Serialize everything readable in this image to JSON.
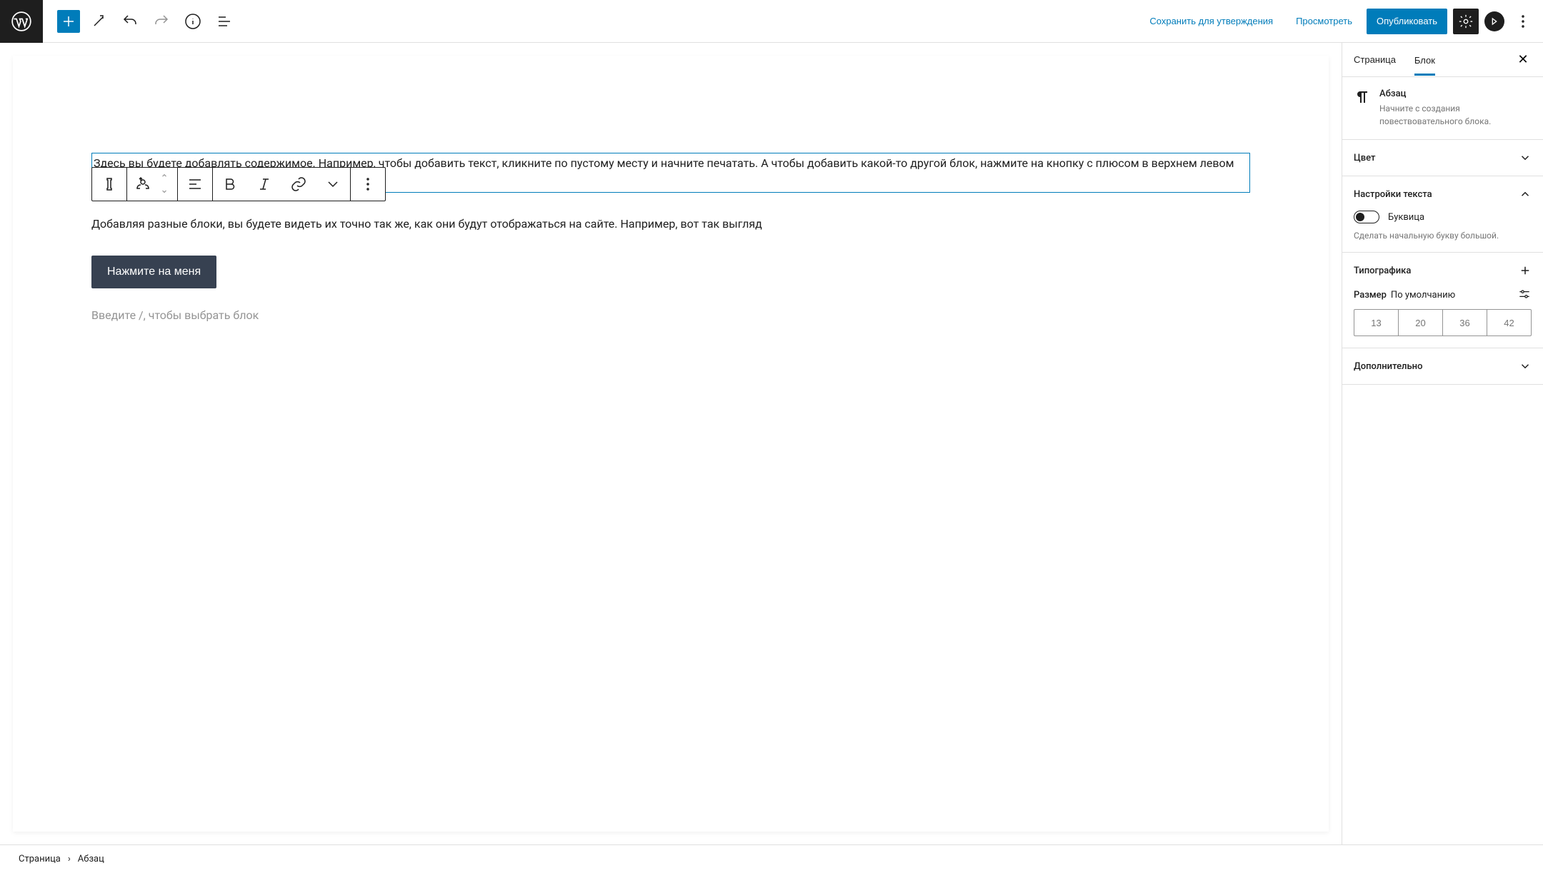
{
  "header": {
    "save": "Сохранить для утверждения",
    "preview": "Просмотреть",
    "publish": "Опубликовать"
  },
  "content": {
    "para1": "Здесь вы будете добавлять содержимое. Например, чтобы добавить текст, кликните по пустому месту и начните печатать. А чтобы добавить какой-то другой блок, нажмите на кнопку с плюсом в верхнем левом углу или справа под последним блоком.",
    "para2": "Добавляя разные блоки, вы будете видеть их точно так же, как они будут отображаться на сайте. Например, вот так выгляд",
    "button": "Нажмите на меня",
    "placeholder": "Введите /, чтобы выбрать блок"
  },
  "sidebar": {
    "tab_page": "Страница",
    "tab_block": "Блок",
    "block_title": "Абзац",
    "block_desc": "Начните с создания повествовательного блока.",
    "color": "Цвет",
    "text_settings": "Настройки текста",
    "dropcap": "Буквица",
    "dropcap_help": "Сделать начальную букву большой.",
    "typography": "Типографика",
    "size": "Размер",
    "size_default": "По умолчанию",
    "sizes": [
      "13",
      "20",
      "36",
      "42"
    ],
    "more": "Дополнительно"
  },
  "footer": {
    "page": "Страница",
    "block": "Абзац"
  }
}
